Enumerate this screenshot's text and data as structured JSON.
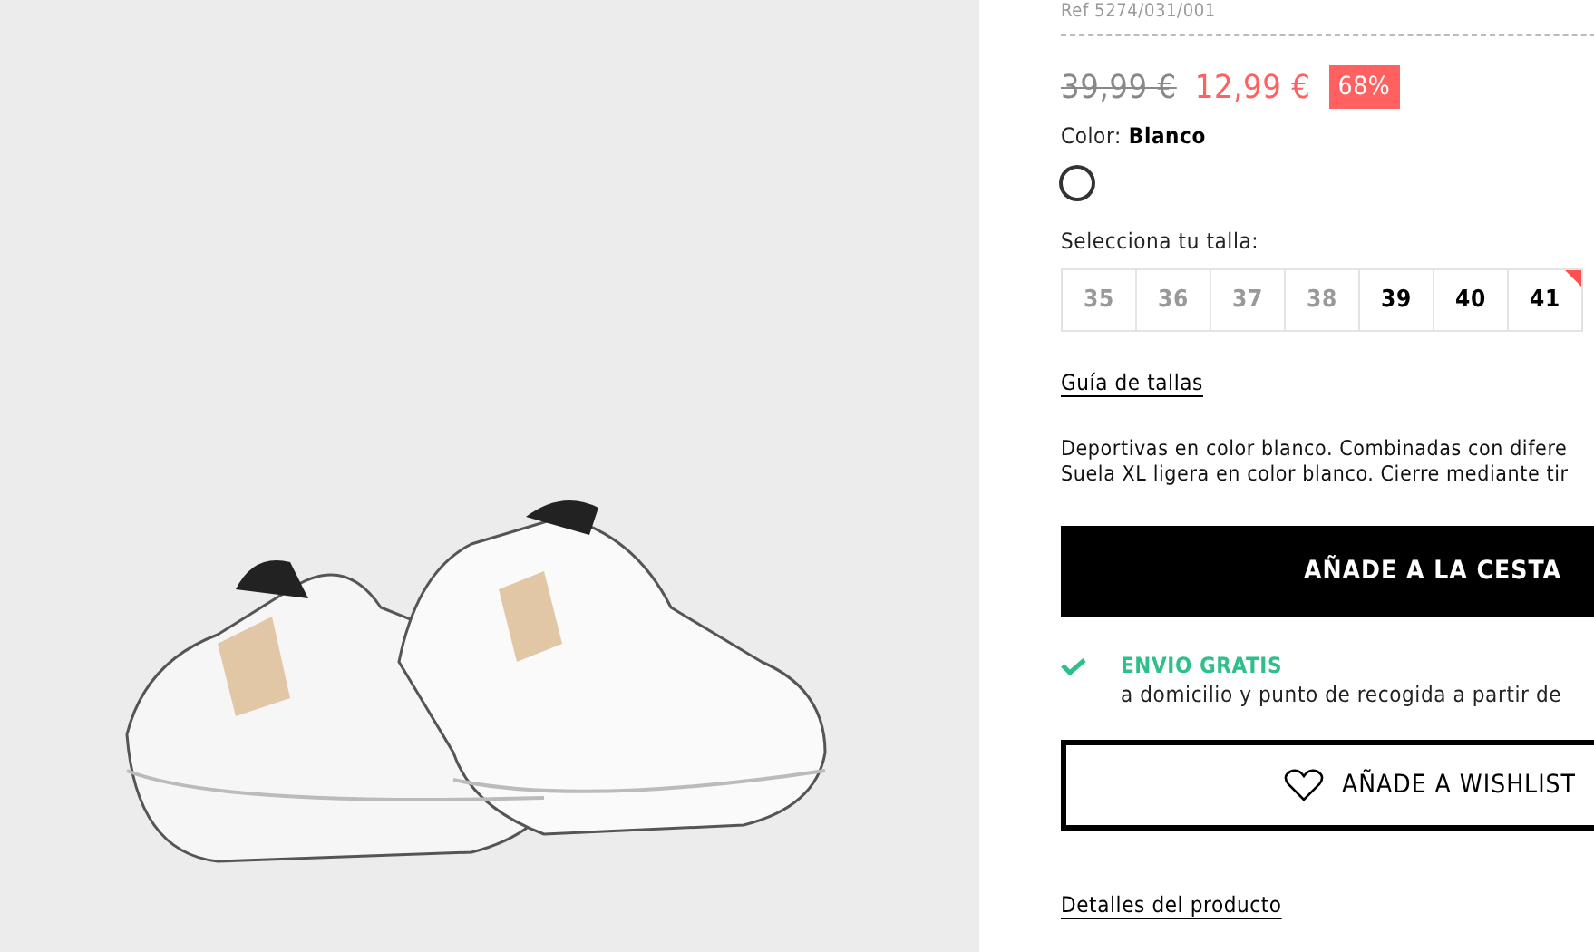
{
  "product": {
    "ref": "Ref 5274/031/001",
    "old_price": "39,99 €",
    "price": "12,99 €",
    "discount": "68%",
    "color_label": "Color:",
    "color_value": "Blanco",
    "swatches": [
      {
        "color": "#ffffff",
        "selected": true
      }
    ],
    "size_label": "Selecciona tu talla:",
    "sizes": [
      {
        "label": "35",
        "disabled": true,
        "low_stock": false
      },
      {
        "label": "36",
        "disabled": true,
        "low_stock": false
      },
      {
        "label": "37",
        "disabled": true,
        "low_stock": false
      },
      {
        "label": "38",
        "disabled": true,
        "low_stock": false
      },
      {
        "label": "39",
        "disabled": false,
        "low_stock": false
      },
      {
        "label": "40",
        "disabled": false,
        "low_stock": false
      },
      {
        "label": "41",
        "disabled": false,
        "low_stock": true
      }
    ],
    "size_guide": "Guía de tallas",
    "description": [
      "Deportivas en color blanco. Combinadas con difere",
      "Suela XL ligera en color blanco. Cierre mediante tir"
    ],
    "add_to_cart": "AÑADE A LA CESTA",
    "shipping_title": "ENVIO GRATIS",
    "shipping_text": "a domicilio y punto de recogida a partir de",
    "wishlist": "AÑADE A WISHLIST",
    "details": "Detalles del producto"
  }
}
